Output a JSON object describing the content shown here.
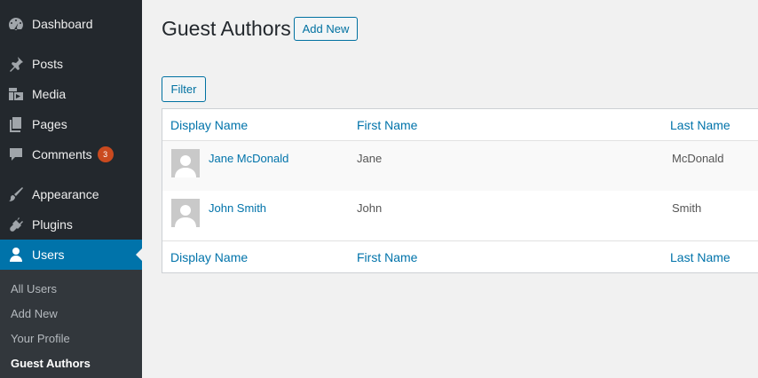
{
  "sidebar": {
    "items": [
      {
        "label": "Dashboard",
        "icon": "dashboard-icon"
      },
      {
        "label": "Posts",
        "icon": "pin-icon"
      },
      {
        "label": "Media",
        "icon": "media-icon"
      },
      {
        "label": "Pages",
        "icon": "pages-icon"
      },
      {
        "label": "Comments",
        "icon": "comment-icon",
        "badge": "3"
      },
      {
        "label": "Appearance",
        "icon": "brush-icon"
      },
      {
        "label": "Plugins",
        "icon": "plug-icon"
      },
      {
        "label": "Users",
        "icon": "user-icon",
        "active": true
      }
    ],
    "submenu": [
      {
        "label": "All Users"
      },
      {
        "label": "Add New"
      },
      {
        "label": "Your Profile"
      },
      {
        "label": "Guest Authors",
        "current": true
      }
    ]
  },
  "main": {
    "title": "Guest Authors",
    "add_new_label": "Add New",
    "filter_label": "Filter",
    "columns": [
      "Display Name",
      "First Name",
      "Last Name"
    ],
    "rows": [
      {
        "display_name": "Jane McDonald",
        "first_name": "Jane",
        "last_name": "McDonald"
      },
      {
        "display_name": "John Smith",
        "first_name": "John",
        "last_name": "Smith"
      }
    ]
  },
  "colors": {
    "sidebar_bg": "#23282d",
    "active_bg": "#0073aa",
    "link": "#0073aa",
    "badge": "#ca4a1f"
  }
}
